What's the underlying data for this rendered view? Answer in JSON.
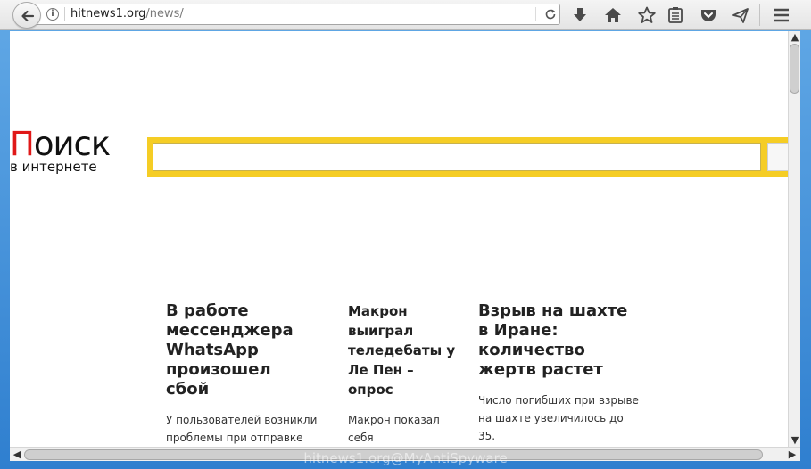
{
  "browser": {
    "url_host": "hitnews1.org",
    "url_path": "/news/",
    "toolbar_icons": [
      "download-icon",
      "home-icon",
      "bookmark-star-icon",
      "reading-list-icon",
      "pocket-icon",
      "send-icon",
      "menu-icon"
    ]
  },
  "page": {
    "logo": {
      "first_letter": "П",
      "rest": "оиск",
      "subtitle": "в интернете"
    },
    "search": {
      "value": "",
      "button_label": ""
    },
    "news": [
      {
        "title": "В работе мессенджера WhatsApp произошел сбой",
        "text": "У пользователей возникли проблемы при отправке сообщений с помощью"
      },
      {
        "title": "Макрон выиграл теледебаты у Ле Пен – опрос",
        "text": "Макрон показал себя убедительнее"
      },
      {
        "title": "Взрыв на шахте в Иране: количество жертв растет",
        "text": "Число погибших при взрыве на шахте увеличилось до 35."
      }
    ]
  },
  "colors": {
    "search_border": "#f5cd25",
    "logo_red": "#e01818",
    "frame_blue": "#3a8fd6"
  },
  "watermark": "hitnews1.org@MyAntiSpyware"
}
